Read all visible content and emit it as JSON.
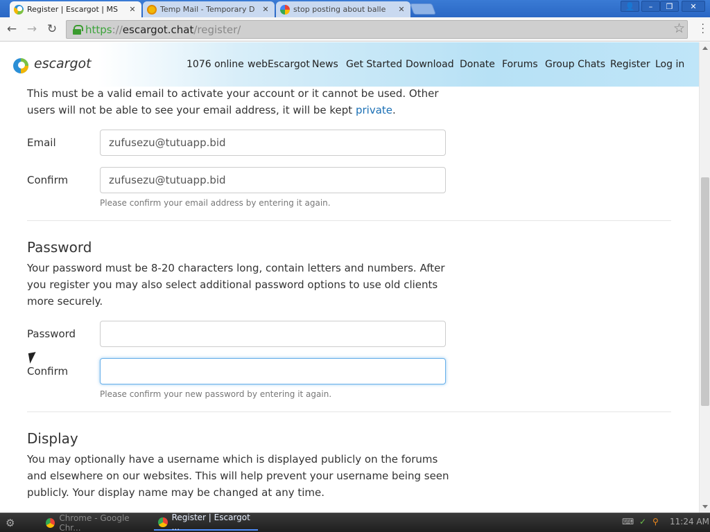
{
  "browser": {
    "tabs": [
      {
        "title": "Register | Escargot | MS",
        "active": true,
        "favicon": "escargot-favicon"
      },
      {
        "title": "Temp Mail - Temporary D",
        "active": false,
        "favicon": "tempmail-favicon"
      },
      {
        "title": "stop posting about balle",
        "active": false,
        "favicon": "google-favicon"
      }
    ],
    "close_glyph": "✕",
    "window_controls": {
      "user": "👤",
      "minimize": "–",
      "restore": "❐",
      "close": "✕"
    },
    "url": {
      "scheme": "https",
      "sep": "://",
      "host": "escargot.chat",
      "path": "/register/"
    }
  },
  "site": {
    "brand": "escargot",
    "nav": [
      "1076 online",
      "webEscargot",
      "News",
      "Get Started",
      "Download",
      "Donate",
      "Forums",
      "Group Chats",
      "Register",
      "Log in"
    ]
  },
  "email_section": {
    "intro_part1": "This must be a valid email to activate your account or it cannot be used. Other users will not be able to see your email address, it will be kept ",
    "intro_link": "private",
    "intro_end": ".",
    "email_label": "Email",
    "email_value": "zufusezu@tutuapp.bid",
    "confirm_label": "Confirm",
    "confirm_value": "zufusezu@tutuapp.bid",
    "confirm_help": "Please confirm your email address by entering it again."
  },
  "password_section": {
    "heading": "Password",
    "intro": "Your password must be 8-20 characters long, contain letters and numbers. After you register you may also select additional password options to use old clients more securely.",
    "password_label": "Password",
    "password_value": "",
    "confirm_label": "Confirm",
    "confirm_value": "",
    "confirm_help": "Please confirm your new password by entering it again."
  },
  "display_section": {
    "heading": "Display",
    "intro": "You may optionally have a username which is displayed publicly on the forums and elsewhere on our websites. This will help prevent your username being seen publicly. Your display name may be changed at any time."
  },
  "taskbar": {
    "items": [
      {
        "label": "Chrome - Google Chr...",
        "active": false
      },
      {
        "label": "Register | Escargot ...",
        "active": true
      }
    ],
    "clock": "11:24 AM"
  },
  "colors": {
    "link": "#1a6fb4",
    "focus_ring": "#66afe9",
    "header_gradient": "#b7e1f5"
  }
}
